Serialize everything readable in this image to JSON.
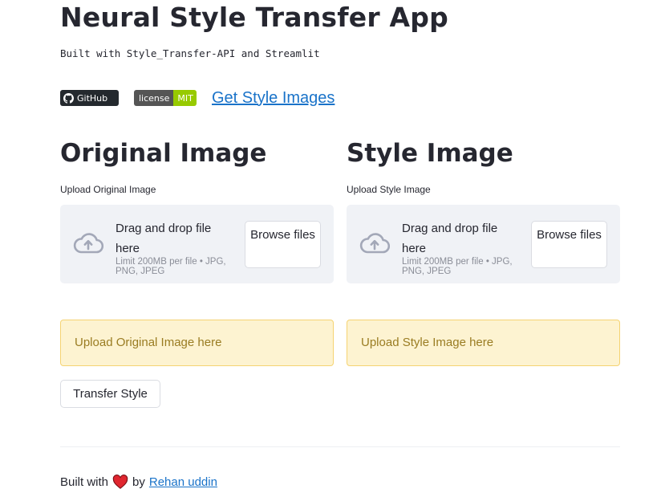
{
  "header": {
    "title": "Neural Style Transfer App",
    "subtitle": "Built with Style_Transfer-API and Streamlit"
  },
  "badges": {
    "github": {
      "icon": "github-icon",
      "label": "GitHub",
      "color": "#24292e"
    },
    "license": {
      "left": "license",
      "right": "MIT",
      "left_color": "#555555",
      "right_color": "#97ca00"
    },
    "style_link": "Get Style Images"
  },
  "original": {
    "heading": "Original Image",
    "upload_label": "Upload Original Image",
    "dropzone": {
      "icon": "cloud-upload-icon",
      "main_text": "Drag and drop file here",
      "limit_text": "Limit 200MB per file • JPG, PNG, JPEG",
      "browse_label": "Browse files"
    },
    "alert": "Upload Original Image here"
  },
  "style": {
    "heading": "Style Image",
    "upload_label": "Upload Style Image",
    "dropzone": {
      "icon": "cloud-upload-icon",
      "main_text": "Drag and drop file here",
      "limit_text": "Limit 200MB per file • JPG, PNG, JPEG",
      "browse_label": "Browse files"
    },
    "alert": "Upload Style Image here"
  },
  "actions": {
    "transfer_label": "Transfer Style"
  },
  "footer": {
    "built_with": "Built with",
    "heart_icon": "heart-icon",
    "by": "by",
    "author": "Rehan uddin"
  },
  "colors": {
    "text": "#262730",
    "link": "#1a73c9",
    "dropzone_bg": "#f0f2f6",
    "alert_bg": "#fdf3d1",
    "alert_border": "#f5d372",
    "alert_text": "#9a7c22",
    "heart": "#e0262f"
  }
}
